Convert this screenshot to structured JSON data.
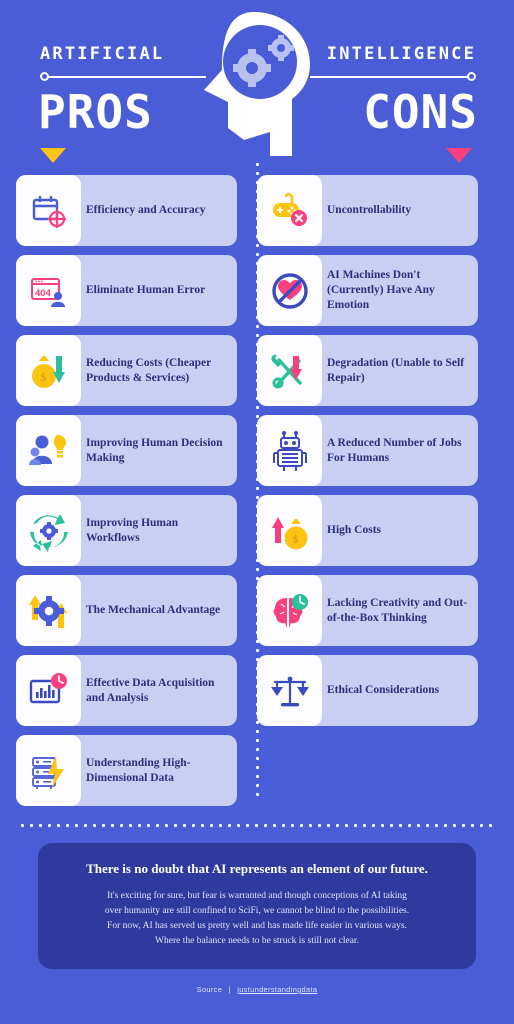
{
  "header": {
    "kicker_left": "ARTIFICIAL",
    "kicker_right": "INTELLIGENCE",
    "title_left": "PROS",
    "title_right": "CONS",
    "marker_left_color": "#fcc412",
    "marker_right_color": "#f9407f",
    "background_color": "#4a5cd6",
    "head_icon": "head-profile-gears-icon"
  },
  "pros": {
    "items": [
      {
        "label": "Efficiency and Accuracy",
        "icon": "calendar-target-icon"
      },
      {
        "label": "Eliminate Human Error",
        "icon": "browser-404-person-icon"
      },
      {
        "label": "Reducing Costs (Cheaper Products & Services)",
        "icon": "money-bag-down-arrow-icon"
      },
      {
        "label": "Improving Human Decision Making",
        "icon": "people-lightbulb-icon"
      },
      {
        "label": "Improving Human Workflows",
        "icon": "recycle-gear-icon"
      },
      {
        "label": "The Mechanical Advantage",
        "icon": "gear-up-arrows-icon"
      },
      {
        "label": "Effective Data Acquisition and Analysis",
        "icon": "bar-chart-clock-icon"
      },
      {
        "label": "Understanding High-Dimensional Data",
        "icon": "server-lightning-icon"
      }
    ]
  },
  "cons": {
    "items": [
      {
        "label": "Uncontrollability",
        "icon": "gamepad-error-icon"
      },
      {
        "label": "AI Machines Don't (Currently) Have Any Emotion",
        "icon": "no-heart-icon"
      },
      {
        "label": "Degradation (Unable to Self Repair)",
        "icon": "wrench-screwdriver-down-arrow-icon"
      },
      {
        "label": "A Reduced Number of Jobs For Humans",
        "icon": "robot-icon"
      },
      {
        "label": "High Costs",
        "icon": "money-bag-up-arrow-icon"
      },
      {
        "label": "Lacking Creativity and Out-of-the-Box Thinking",
        "icon": "brain-clock-icon"
      },
      {
        "label": "Ethical Considerations",
        "icon": "scales-balance-icon"
      }
    ]
  },
  "footer": {
    "title": "There is no doubt that AI represents an element of our future.",
    "body_lines": [
      "It's exciting for sure, but fear is warranted and though conceptions of AI taking",
      "over humanity are still confined to SciFi, we cannot be blind to the possibilities.",
      "For now, AI has served us pretty well and has made life easier in various ways.",
      "Where the balance needs to be struck is still not clear."
    ],
    "source_label": "Source",
    "source_separator": "|",
    "source_link": "justunderstandingdata",
    "panel_color": "#2e3a9e"
  }
}
